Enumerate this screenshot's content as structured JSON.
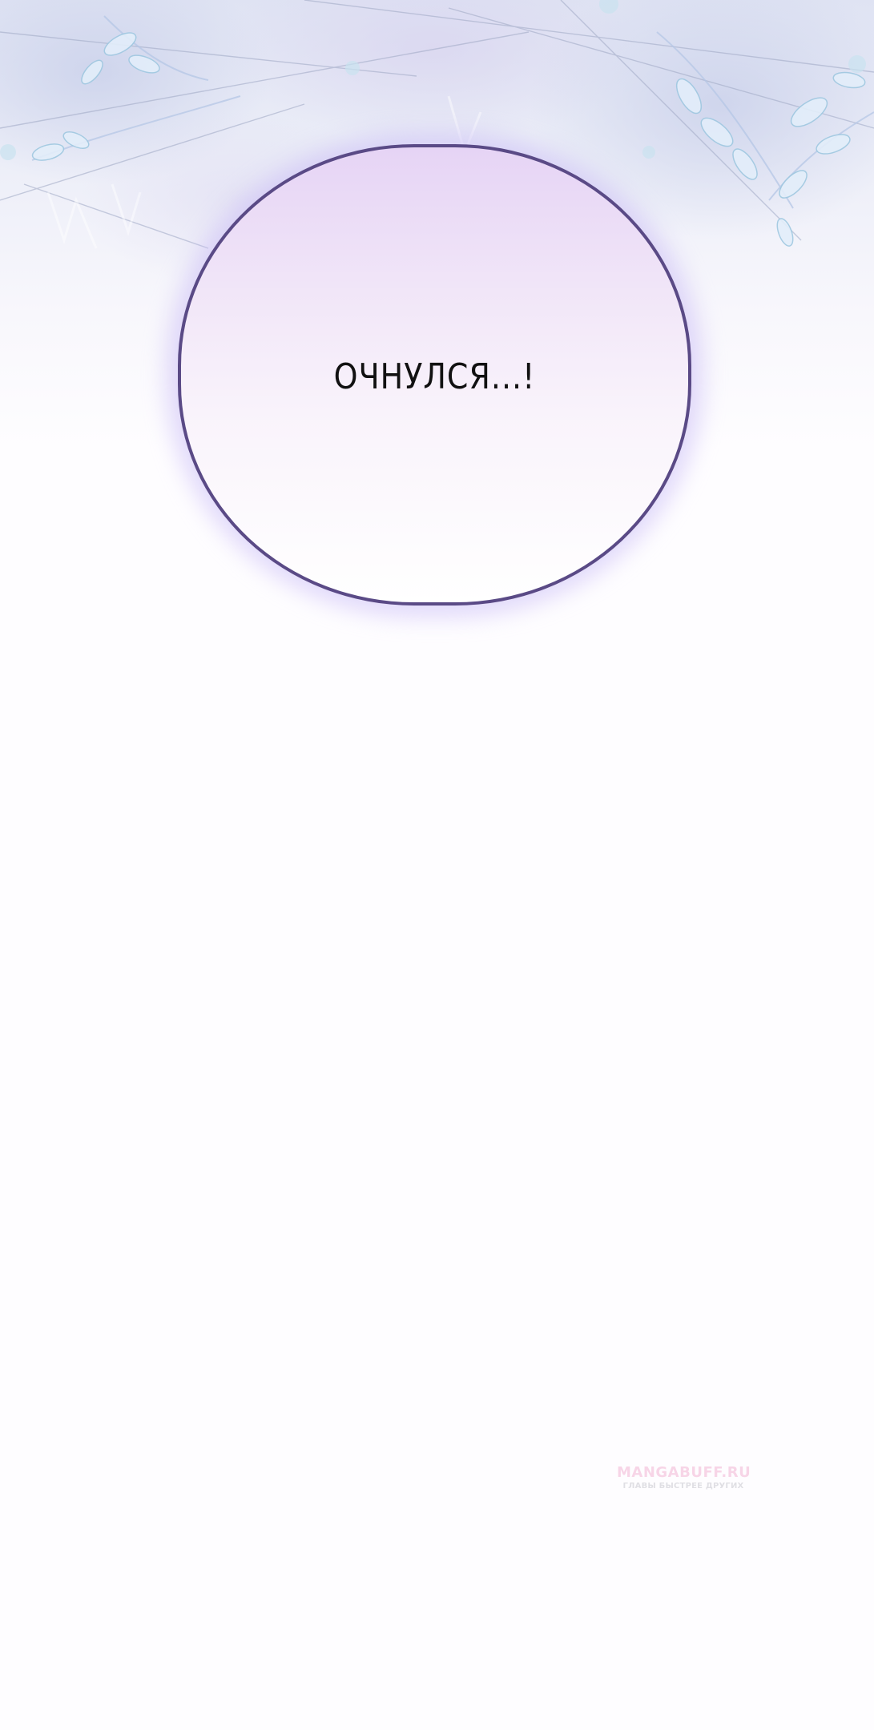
{
  "speech_bubble": {
    "text": "ОЧНУЛСЯ...!"
  },
  "watermark": {
    "brand": "MANGABUFF.RU",
    "tagline": "ГЛАВЫ БЫСТРЕЕ ДРУГИХ"
  },
  "colors": {
    "bubble_outline": "#5a4a86",
    "bubble_top": "#e6d4f5",
    "bubble_bottom": "#ffffff",
    "background": "#fefdff",
    "watermark_brand": "#f3b6d4"
  }
}
